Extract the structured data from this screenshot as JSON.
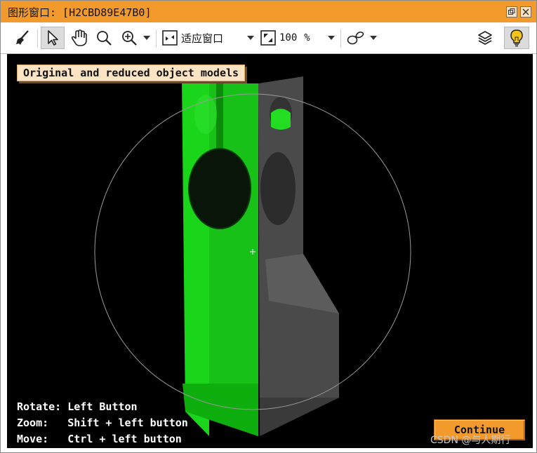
{
  "window": {
    "title": "图形窗口: [H2CBD89E47B0]",
    "restore_icon": "restore-icon",
    "close_icon": "close-icon"
  },
  "toolbar": {
    "clear_icon": "broom-icon",
    "select_icon": "pointer-icon",
    "pan_icon": "hand-icon",
    "zoom_icon": "magnifier-icon",
    "zoom_in_icon": "magnifier-plus-icon",
    "fit_label": "适应窗口",
    "scale_value": "100",
    "scale_unit": "%",
    "shape_icon": "shapes-icon",
    "layers_icon": "layers-icon",
    "tips_icon": "lightbulb-icon"
  },
  "viewport": {
    "background": "#000000",
    "caption": "Original and reduced object models",
    "help_rotate": "Rotate: Left Button",
    "help_zoom": "Zoom:   Shift + left button",
    "help_move": "Move:   Ctrl + left button",
    "continue_label": "Continue",
    "model_colors": {
      "original": "#22cc22",
      "reduced": "#555555"
    }
  },
  "watermark": "CSDN @与人期行",
  "colors": {
    "titlebar": "#f39a2c",
    "accent_button": "#f39a2c"
  }
}
